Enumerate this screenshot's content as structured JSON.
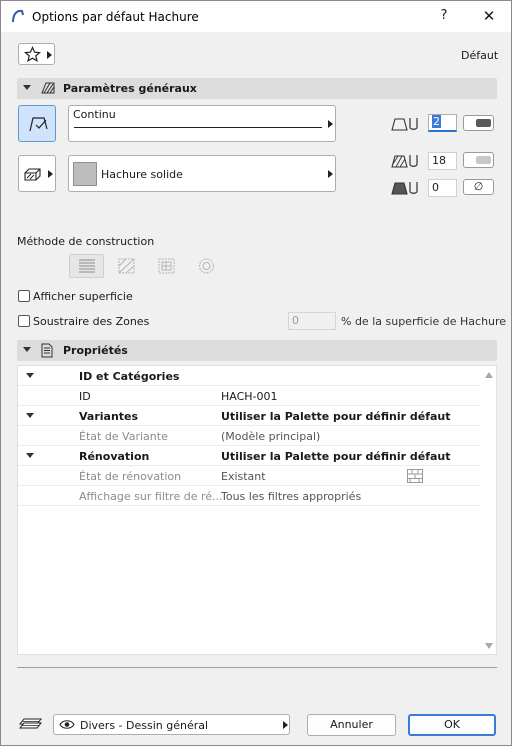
{
  "window": {
    "title": "Options par défaut Hachure",
    "help_label": "?",
    "close_label": "✕"
  },
  "top": {
    "preset_label": "Défaut"
  },
  "general": {
    "title": "Paramètres généraux",
    "line_type": "Continu",
    "fill_type": "Hachure solide",
    "pen1": "2",
    "pen2": "18",
    "pen3": "0",
    "pen3_btn": "∅",
    "colors": {
      "pen1": "#5a5a5a",
      "pen2": "#c8c8c8"
    }
  },
  "construction": {
    "label": "Méthode de construction"
  },
  "options": {
    "show_area": "Afficher superficie",
    "subtract_zones": "Soustraire des Zones",
    "percent_value": "0",
    "percent_label": "% de la superficie de Hachure"
  },
  "properties": {
    "title": "Propriétés",
    "rows": [
      {
        "name": "ID et Catégories",
        "value": ""
      },
      {
        "name": "ID",
        "value": "HACH-001"
      },
      {
        "name": "Variantes",
        "value": "Utiliser la Palette pour définir défaut"
      },
      {
        "name": "État de Variante",
        "value": "(Modèle principal)"
      },
      {
        "name": "Rénovation",
        "value": "Utiliser la Palette pour définir défaut"
      },
      {
        "name": "État de rénovation",
        "value": "Existant"
      },
      {
        "name": "Affichage sur filtre de ré...",
        "value": "Tous les filtres appropriés"
      }
    ]
  },
  "footer": {
    "layer": "Divers - Dessin général",
    "cancel": "Annuler",
    "ok": "OK"
  }
}
